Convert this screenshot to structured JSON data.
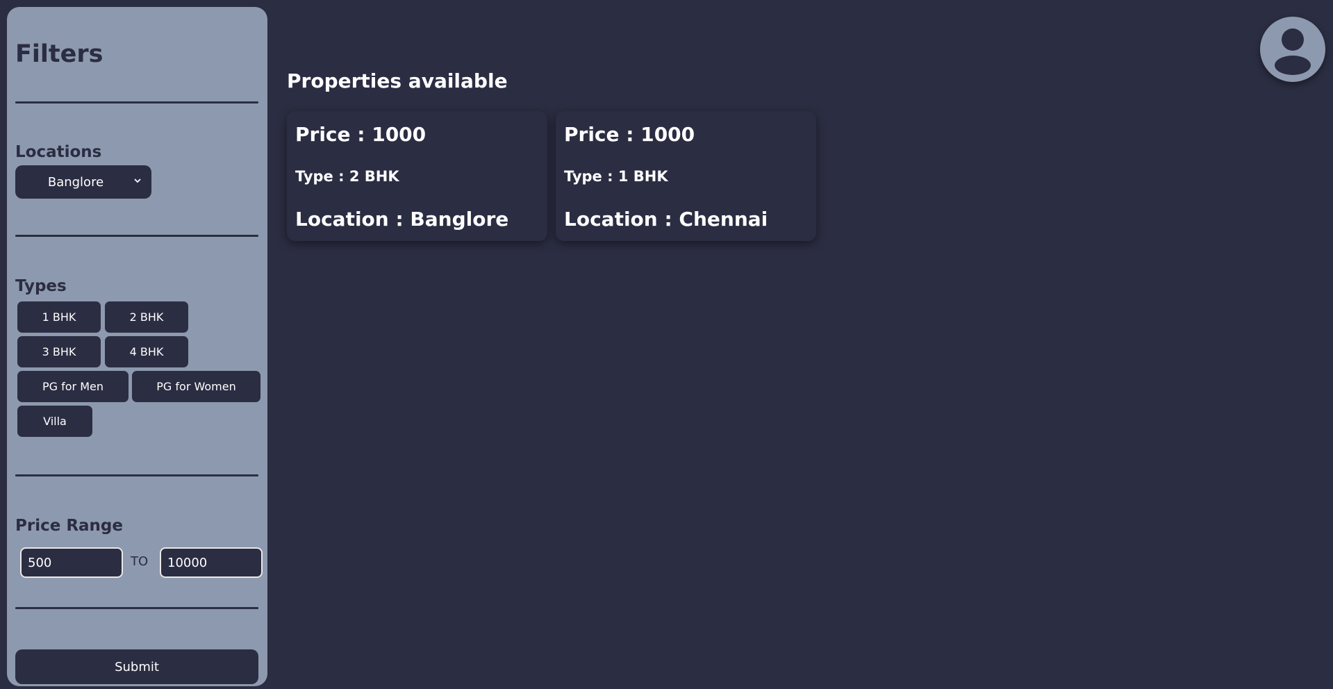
{
  "sidebar": {
    "title": "Filters",
    "locations": {
      "title": "Locations",
      "selected": "Banglore"
    },
    "types": {
      "title": "Types",
      "options": [
        "1 BHK",
        "2 BHK",
        "3 BHK",
        "4 BHK",
        "PG for Men",
        "PG for Women",
        "Villa"
      ]
    },
    "price_range": {
      "title": "Price Range",
      "min": "500",
      "separator": "TO",
      "max": "10000"
    },
    "submit_label": "Submit"
  },
  "main": {
    "title": "Properties available",
    "cards": [
      {
        "price": "Price : 1000",
        "type": "Type : 2 BHK",
        "location": "Location : Banglore"
      },
      {
        "price": "Price : 1000",
        "type": "Type : 1 BHK",
        "location": "Location : Chennai"
      }
    ]
  },
  "icons": {
    "avatar": "user-avatar-icon",
    "select_chevron": "chevron-down-icon"
  },
  "colors": {
    "background": "#2b2d42",
    "sidebar": "#8d99ae",
    "text_light": "#ffffff"
  }
}
